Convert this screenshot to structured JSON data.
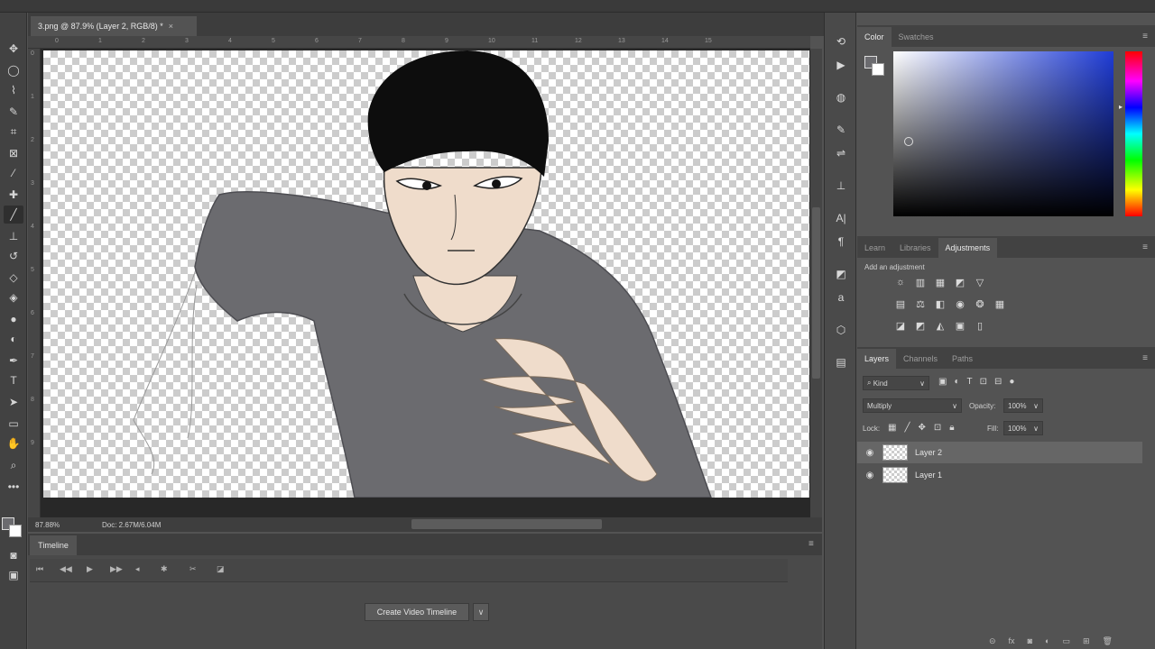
{
  "document": {
    "tab_title": "3.png @ 87.9% (Layer 2, RGB/8) *",
    "close": "×",
    "zoom_status": "87.88%",
    "doc_info": "Doc: 2.67M/6.04M"
  },
  "ruler": {
    "top_ticks": [
      "0",
      "1",
      "2",
      "3",
      "4",
      "5",
      "6",
      "7",
      "8",
      "9",
      "10",
      "11",
      "12",
      "13",
      "14",
      "15"
    ],
    "left_ticks": [
      "0",
      "1",
      "2",
      "3",
      "4",
      "5",
      "6",
      "7",
      "8",
      "9"
    ]
  },
  "timeline": {
    "tab": "Timeline",
    "create_button": "Create Video Timeline"
  },
  "color_panel": {
    "tabs": [
      "Color",
      "Swatches"
    ],
    "active_tab": "Color"
  },
  "adjust_panel": {
    "tabs": [
      "Learn",
      "Libraries",
      "Adjustments"
    ],
    "active_tab": "Adjustments",
    "add_label": "Add an adjustment"
  },
  "layers_panel": {
    "tabs": [
      "Layers",
      "Channels",
      "Paths"
    ],
    "active_tab": "Layers",
    "filter": "Kind",
    "blend_mode": "Multiply",
    "opacity_label": "Opacity:",
    "opacity_value": "100%",
    "lock_label": "Lock:",
    "fill_label": "Fill:",
    "fill_value": "100%",
    "layers": [
      {
        "name": "Layer 2",
        "selected": true
      },
      {
        "name": "Layer 1",
        "selected": false
      }
    ]
  },
  "colors": {
    "sweater": "#6b6b6f",
    "skin": "#efdccb",
    "hair": "#0d0d0d"
  }
}
